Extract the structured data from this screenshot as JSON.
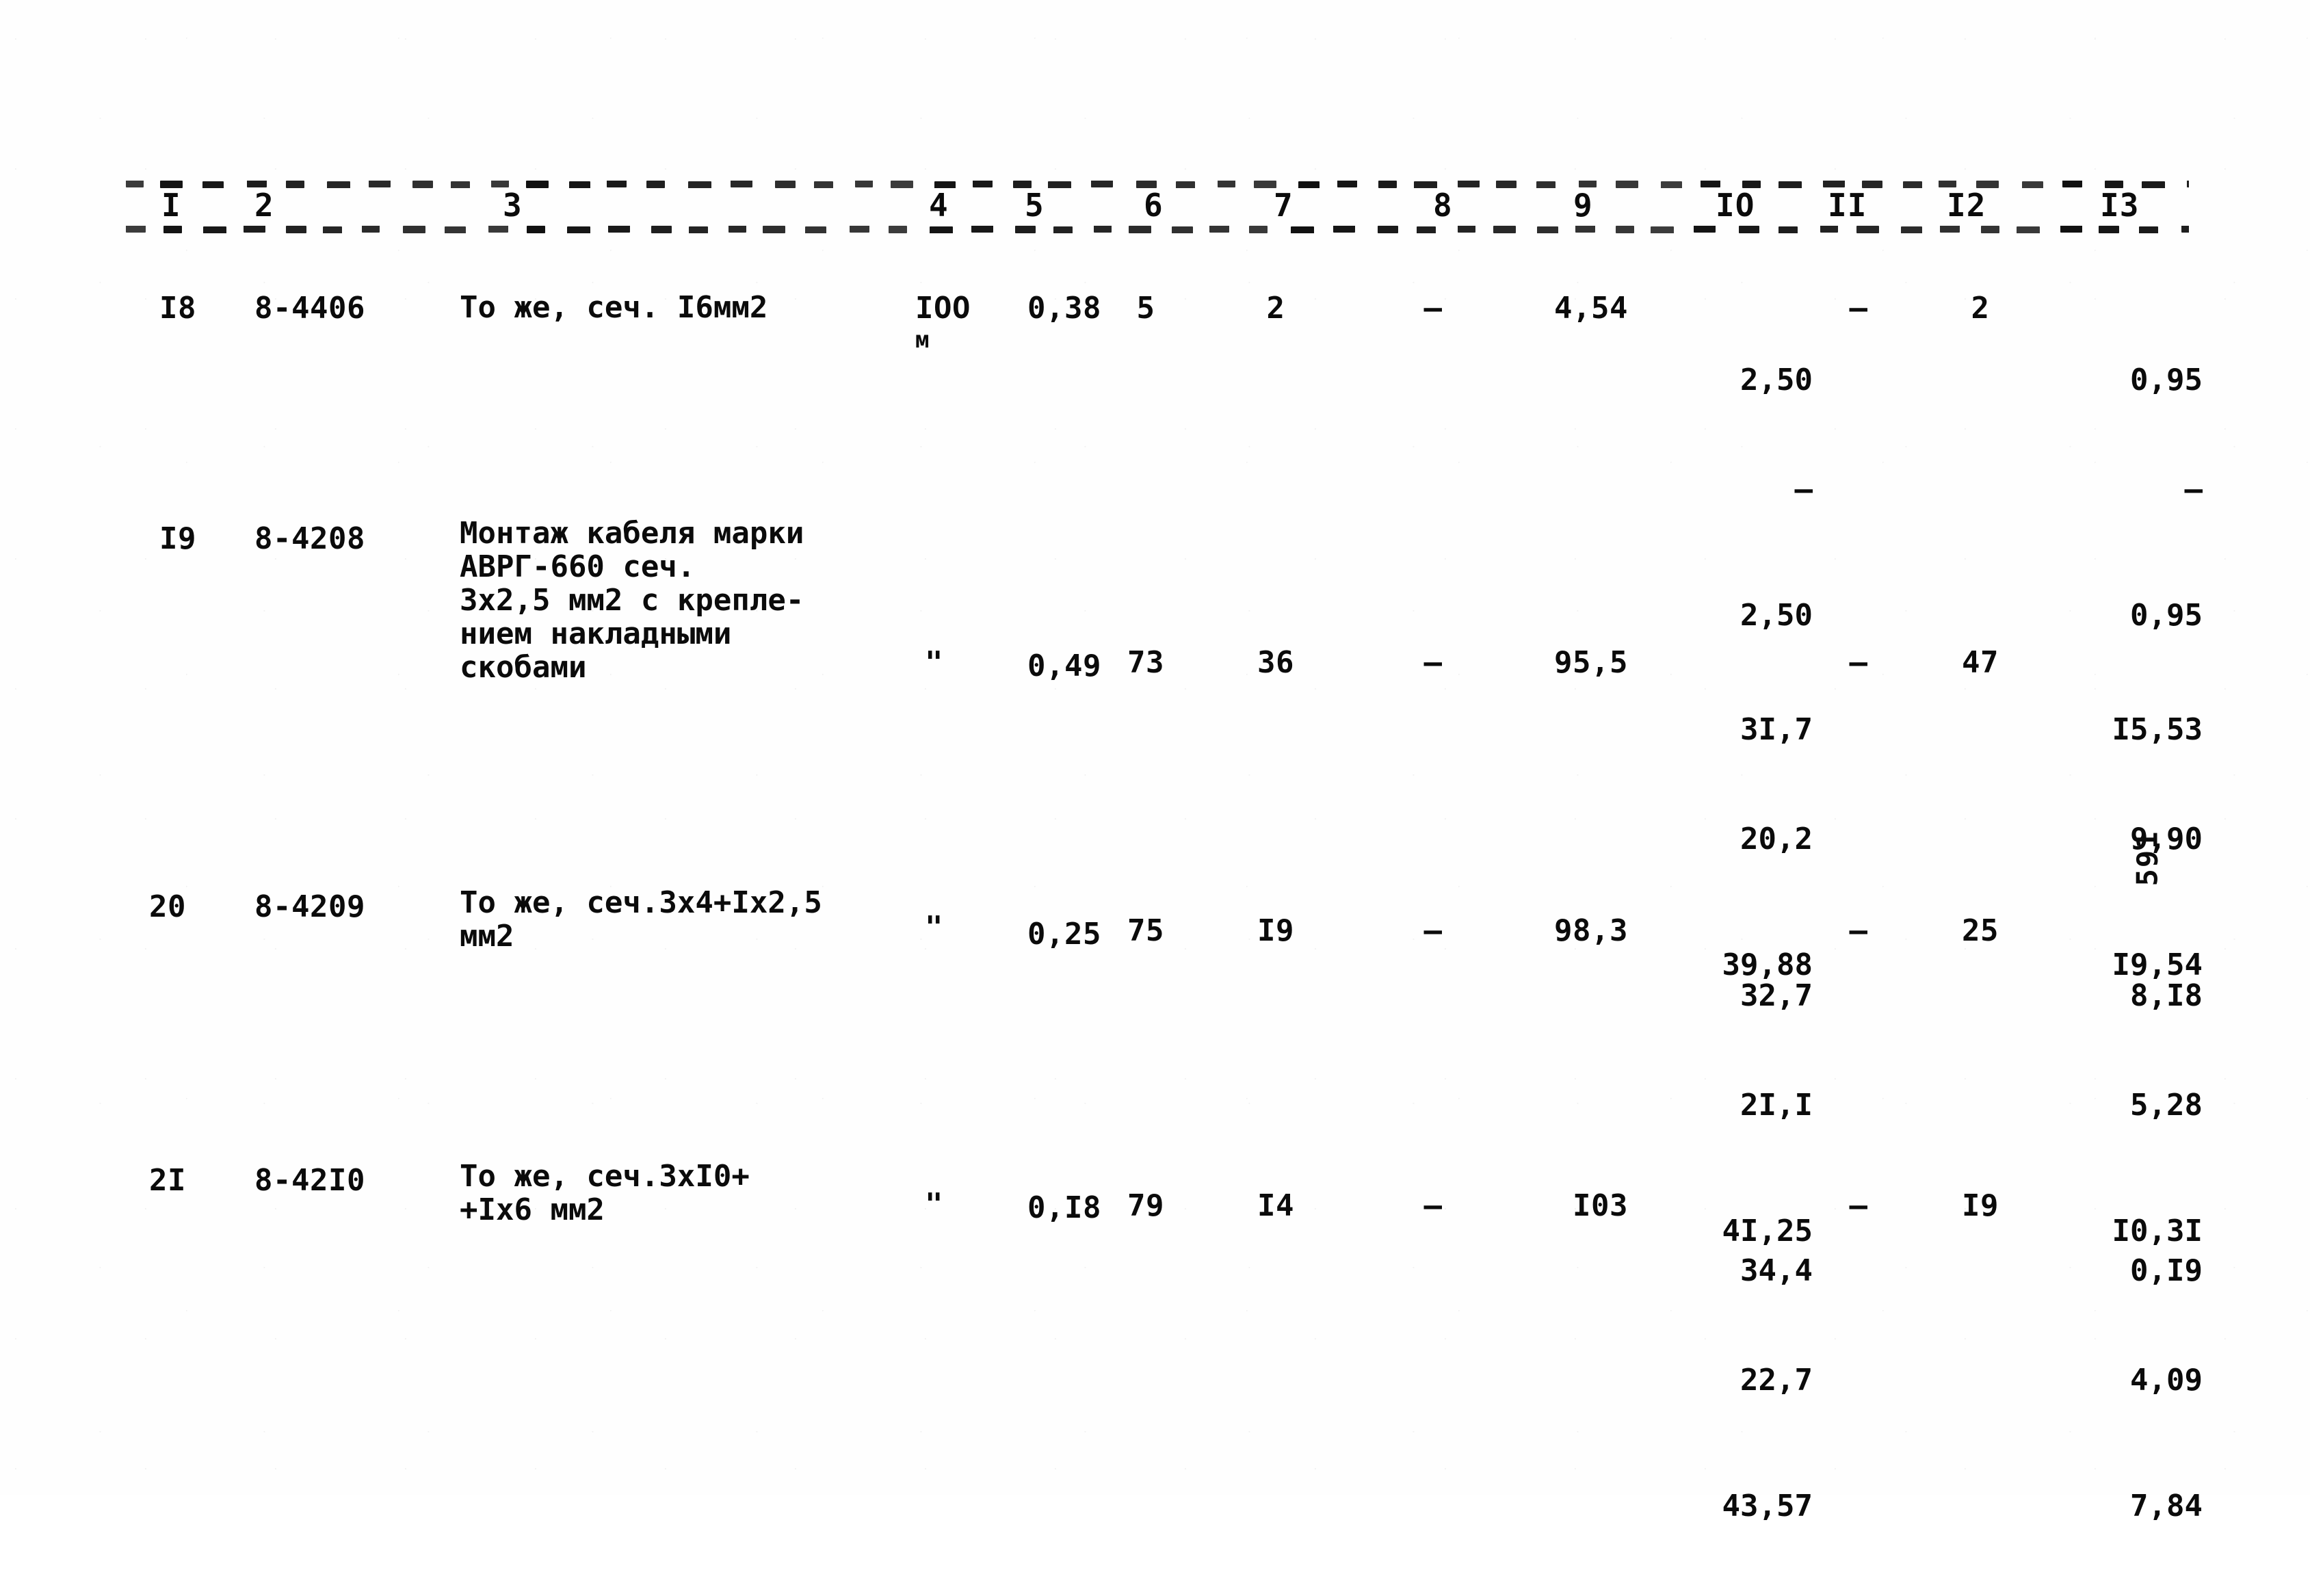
{
  "document": {
    "type": "typewritten-cost-estimate-table",
    "page_number": "591",
    "ink_color": "#111111",
    "paper_color": "#fefefe"
  },
  "table": {
    "column_headers": [
      "I",
      "2",
      "3",
      "4",
      "5",
      "6",
      "7",
      "8",
      "9",
      "IO",
      "II",
      "I2",
      "I3"
    ],
    "rows": [
      {
        "c1": "I8",
        "c2": "8-4406",
        "c3": "То же, сеч. I6мм2",
        "c4": "IOO",
        "c4b": "м",
        "c5": "0,38",
        "c6": "5",
        "c7": "2",
        "c8": "–",
        "c9": "4,54",
        "c10": [
          "2,50",
          "–",
          "2,50"
        ],
        "c11": "–",
        "c12": "2",
        "c13": [
          "0,95",
          "–",
          "0,95"
        ]
      },
      {
        "c1": "I9",
        "c2": "8-4208",
        "c3": "Монтаж кабеля марки\nАВРГ-660 сеч.\n3х2,5 мм2 с крепле-\nнием накладными\nскобами",
        "c4": "\"",
        "c4b": "",
        "c5": "0,49",
        "c6": "73",
        "c7": "36",
        "c8": "–",
        "c9": "95,5",
        "c10": [
          "3I,7",
          "20,2",
          "39,88"
        ],
        "c11": "–",
        "c12": "47",
        "c13": [
          "I5,53",
          "9,90",
          "I9,54"
        ]
      },
      {
        "c1": "20",
        "c2": "8-4209",
        "c3": "То же, сеч.3х4+Iх2,5\nмм2",
        "c4": "\"",
        "c4b": "",
        "c5": "0,25",
        "c6": "75",
        "c7": "I9",
        "c8": "–",
        "c9": "98,3",
        "c10": [
          "32,7",
          "2I,I",
          "4I,25"
        ],
        "c11": "–",
        "c12": "25",
        "c13": [
          "8,I8",
          "5,28",
          "I0,3I"
        ]
      },
      {
        "c1": "2I",
        "c2": "8-42I0",
        "c3": "То же, сеч.3хI0+\n+Iх6 мм2",
        "c4": "\"",
        "c4b": "",
        "c5": "0,I8",
        "c6": "79",
        "c7": "I4",
        "c8": "–",
        "c9": "I03",
        "c10": [
          "34,4",
          "22,7",
          "43,57"
        ],
        "c11": "–",
        "c12": "I9",
        "c13": [
          "0,I9",
          "4,09",
          "7,84"
        ]
      }
    ]
  }
}
